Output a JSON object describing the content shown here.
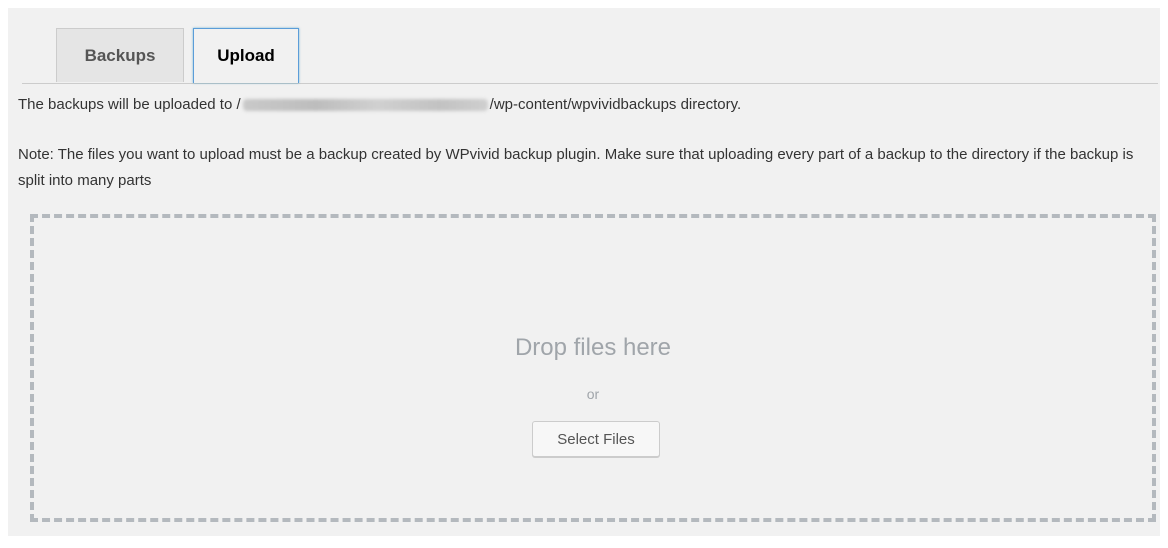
{
  "tabs": {
    "backups_label": "Backups",
    "upload_label": "Upload",
    "active": "Upload"
  },
  "info": {
    "upload_dir_prefix": "The backups will be uploaded to ",
    "upload_dir_path_start": "/",
    "upload_dir_suffix": "/wp-content/wpvividbackups directory."
  },
  "note": {
    "text": "Note: The files you want to upload must be a backup created by WPvivid backup plugin. Make sure that uploading every part of a backup to the directory if the backup is split into many parts"
  },
  "dropzone": {
    "title": "Drop files here",
    "or_text": "or",
    "select_button_label": "Select Files"
  },
  "colors": {
    "background": "#f1f1f1",
    "active_tab_border": "#5b9dd9",
    "dropzone_border": "#b4b9be"
  }
}
